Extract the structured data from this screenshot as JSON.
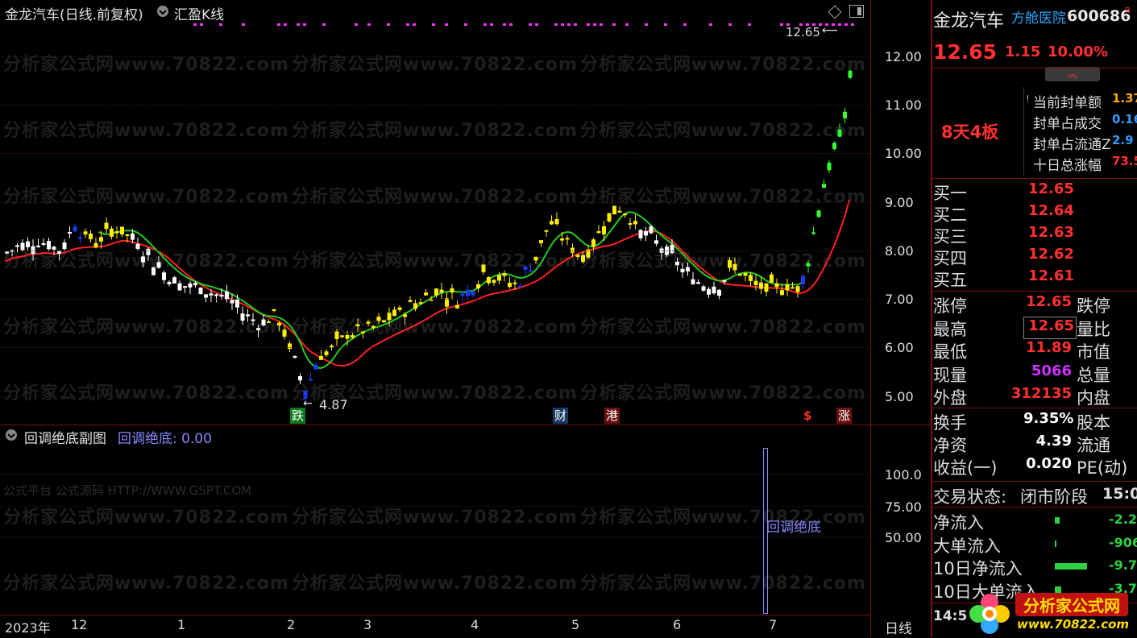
{
  "main_chart": {
    "title": "金龙汽车(日线.前复权)",
    "indicator": "汇盈K线",
    "price_axis": [
      "12.00",
      "11.00",
      "10.00",
      "9.00",
      "8.00",
      "7.00",
      "6.00",
      "5.00"
    ],
    "high_label": "12.65",
    "low_label": "4.87",
    "event_tags": [
      "跌",
      "财",
      "港",
      "$",
      "涨"
    ]
  },
  "sub_chart": {
    "title": "回调绝底副图",
    "indicator_label": "回调绝底: 0.00",
    "axis": [
      "100.0",
      "75.00",
      "50.00"
    ],
    "bar_label": "回调绝底",
    "source_text": "公式平台 公式源码 HTTP://WWW.GSPT.COM"
  },
  "watermark": "分析家公式网www.70822.com",
  "x_axis": {
    "labels": [
      "2023年",
      "12",
      "1",
      "2",
      "3",
      "4",
      "5",
      "6",
      "7"
    ],
    "period": "日线"
  },
  "right_panel": {
    "stock_name": "金龙汽车",
    "concept": "方舱医院",
    "code": "600686",
    "price": "12.65",
    "change": "1.15",
    "change_pct": "10.00%",
    "board_info": "8天4板",
    "seal_rows": [
      {
        "label": "当前封单额",
        "value": "1.37"
      },
      {
        "label": "封单占成交",
        "value": "0.16"
      },
      {
        "label": "封单占流通Z",
        "value": "2.9"
      },
      {
        "label": "十日总涨幅",
        "value": "73.5"
      }
    ],
    "bids": [
      {
        "label": "买一",
        "value": "12.65"
      },
      {
        "label": "买二",
        "value": "12.64"
      },
      {
        "label": "买三",
        "value": "12.63"
      },
      {
        "label": "买四",
        "value": "12.62"
      },
      {
        "label": "买五",
        "value": "12.61"
      }
    ],
    "stats": [
      {
        "label": "涨停",
        "value": "12.65",
        "right": "跌停"
      },
      {
        "label": "最高",
        "value": "12.65",
        "right": "量比"
      },
      {
        "label": "最低",
        "value": "11.89",
        "right": "市值"
      },
      {
        "label": "现量",
        "value": "5066",
        "right": "总量"
      },
      {
        "label": "外盘",
        "value": "312135",
        "right": "内盘"
      }
    ],
    "fund": [
      {
        "label": "换手",
        "value": "9.35%",
        "right": "股本"
      },
      {
        "label": "净资",
        "value": "4.39",
        "right": "流通"
      },
      {
        "label": "收益(一)",
        "value": "0.020",
        "right": "PE(动)"
      }
    ],
    "trade_status_label": "交易状态:",
    "trade_status": "闭市阶段",
    "trade_time": "15:0",
    "flows": [
      {
        "label": "净流入",
        "value": "-2.2"
      },
      {
        "label": "大单流入",
        "value": "-906"
      },
      {
        "label": "10日净流入",
        "value": "-9.7"
      },
      {
        "label": "10日大单流入",
        "value": "-3.7"
      }
    ],
    "bottom_time": "14:5",
    "brand_title": "分析家公式网",
    "brand_url": "www.70822.com"
  },
  "colors": {
    "up_red": "#ff3030",
    "down_green": "#30d040",
    "ma_green": "#22cc22",
    "ma_red": "#ff2020",
    "candle_yellow": "#ffee00",
    "candle_blue": "#1a3cff",
    "candle_white": "#ffffff",
    "candle_limit_green": "#33ff33",
    "indicator_purple": "#8888ff",
    "signal_magenta": "#ff33ff"
  }
}
